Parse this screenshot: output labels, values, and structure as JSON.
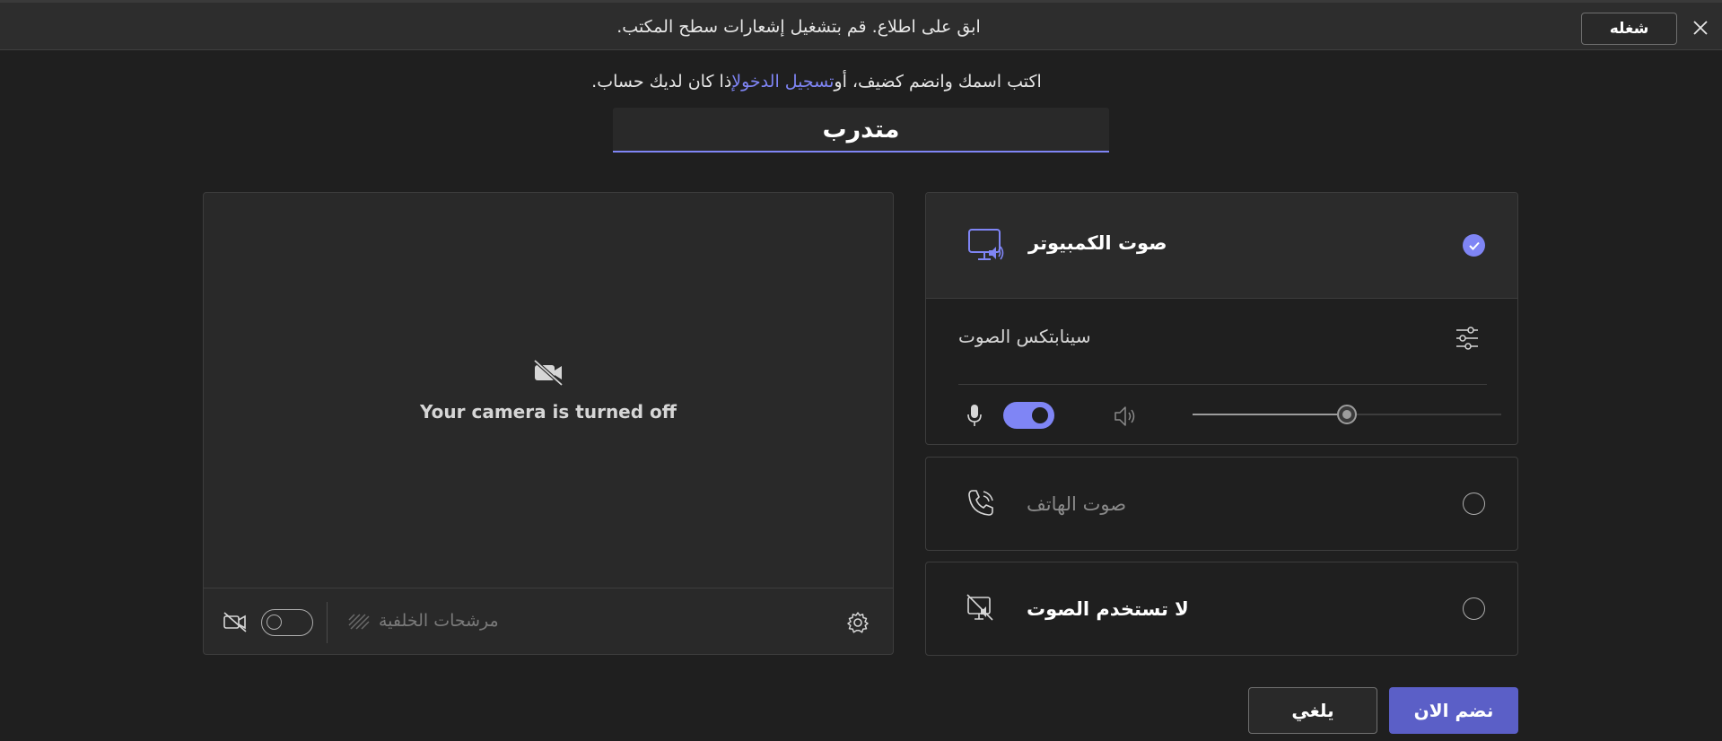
{
  "notification": {
    "message": "ابق على اطلاع. قم بتشغيل إشعارات سطح المكتب.",
    "enable_label": "شغله"
  },
  "name_prompt": {
    "before_link": "اكتب اسمك وانضم كضيف، أو",
    "link": "تسجيل الدخول",
    "after_link": "إذا كان لديك حساب."
  },
  "name_input": {
    "value": "متدرب"
  },
  "camera": {
    "status_text": "Your camera is turned off",
    "background_filters_label": "مرشحات الخلفية",
    "toggle_on": false
  },
  "audio": {
    "computer_audio": {
      "label": "صوت الكمبيوتر",
      "selected": true,
      "device_name": "سينابتكس الصوت",
      "mic_on": true,
      "volume_fraction": 0.5
    },
    "phone_audio": {
      "label": "صوت الهاتف",
      "selected": false
    },
    "no_audio": {
      "label": "لا تستخدم الصوت",
      "selected": false
    }
  },
  "actions": {
    "join_label": "نضم الان",
    "cancel_label": "يلغي"
  },
  "colors": {
    "accent": "#7f85f5",
    "primary_button": "#5b5fc7",
    "background": "#1f1f1f"
  },
  "icons": {
    "close": "close-icon",
    "camera_off": "camera-off-icon",
    "background_filters": "background-effects-icon",
    "settings": "gear-icon",
    "computer_audio": "computer-speaker-icon",
    "device_settings": "sliders-icon",
    "mic": "microphone-icon",
    "speaker": "speaker-icon",
    "phone": "phone-icon",
    "no_audio": "no-audio-icon",
    "checked": "checkmark-icon"
  }
}
